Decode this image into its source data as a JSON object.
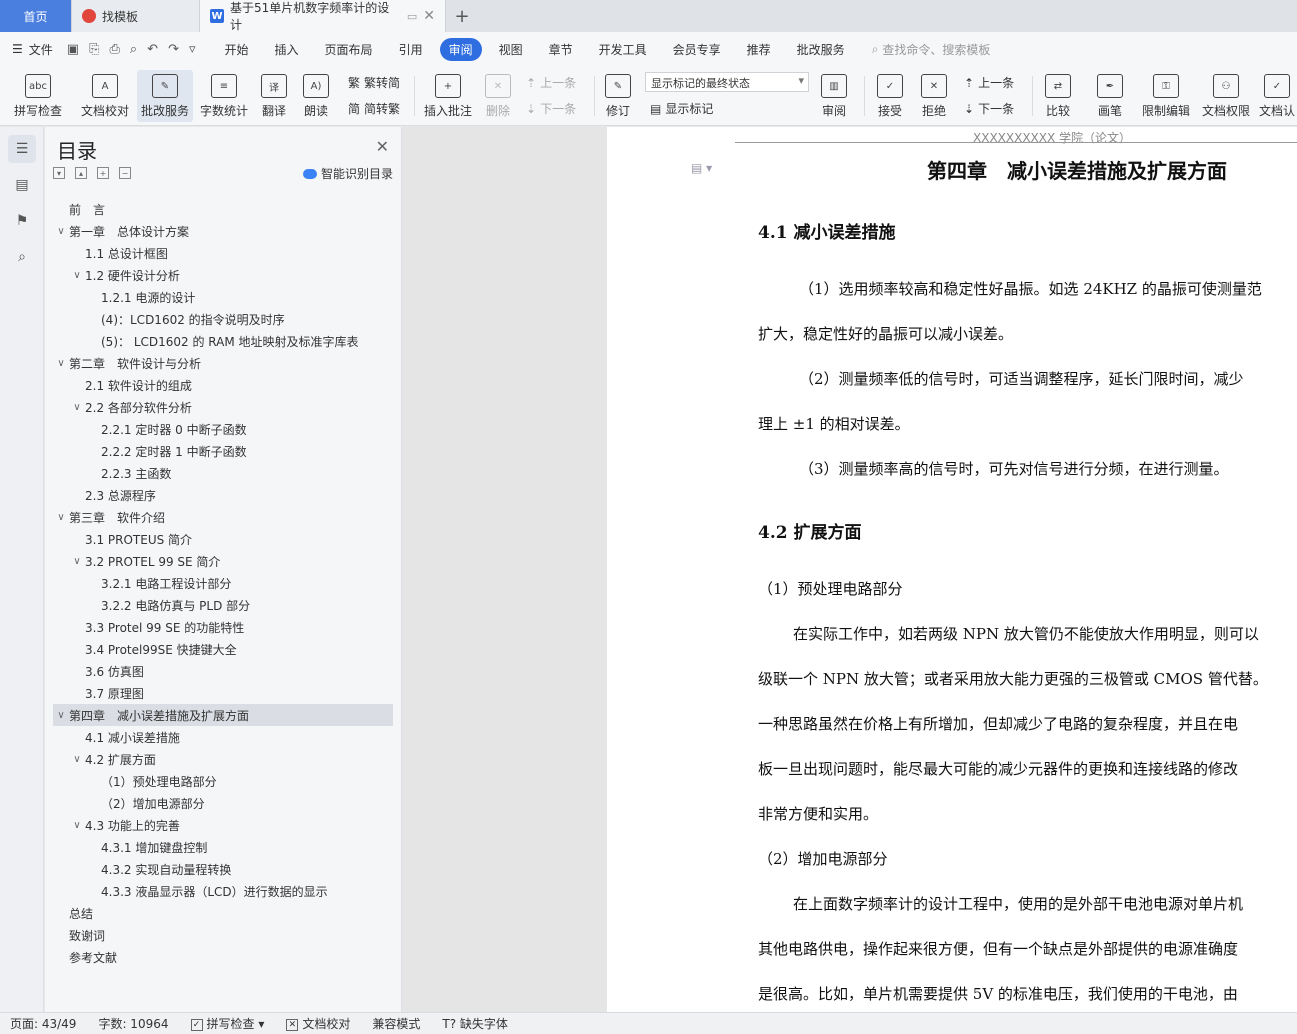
{
  "tabs": {
    "home": "首页",
    "template": "找模板",
    "doc": "基于51单片机数字频率计的设计",
    "add": "+"
  },
  "menu": {
    "file": "文件",
    "items": [
      "开始",
      "插入",
      "页面布局",
      "引用",
      "审阅",
      "视图",
      "章节",
      "开发工具",
      "会员专享",
      "推荐",
      "批改服务"
    ],
    "active_index": 4,
    "search": "查找命令、搜索模板"
  },
  "ribbon": {
    "spell": "拼写检查",
    "proofread": "文档校对",
    "correct": "批改服务",
    "wordcount": "字数统计",
    "translate": "翻译",
    "read": "朗读",
    "trad": "繁转简",
    "simp": "简转繁",
    "insert_comment": "插入批注",
    "delete": "删除",
    "prev_comment": "上一条",
    "next_comment": "下一条",
    "revise": "修订",
    "markup_state": "显示标记的最终状态",
    "show_markup": "显示标记",
    "review": "审阅",
    "accept": "接受",
    "reject": "拒绝",
    "prev": "上一条",
    "next": "下一条",
    "compare": "比较",
    "pen": "画笔",
    "restrict": "限制编辑",
    "permission": "文档权限",
    "certify": "文档认"
  },
  "toc": {
    "title": "目录",
    "smart": "智能识别目录",
    "items": [
      {
        "label": "前　言",
        "level": 0,
        "chev": false
      },
      {
        "label": "第一章　总体设计方案",
        "level": 0,
        "chev": true
      },
      {
        "label": "1.1  总设计框图",
        "level": 1,
        "chev": false
      },
      {
        "label": "1.2  硬件设计分析",
        "level": 1,
        "chev": true
      },
      {
        "label": "1.2.1  电源的设计",
        "level": 2,
        "chev": false
      },
      {
        "label": "(4)：LCD1602 的指令说明及时序",
        "level": 2,
        "chev": false
      },
      {
        "label": "(5)：  LCD1602 的 RAM 地址映射及标准字库表",
        "level": 2,
        "chev": false
      },
      {
        "label": "第二章　软件设计与分析",
        "level": 0,
        "chev": true
      },
      {
        "label": "2.1  软件设计的组成",
        "level": 1,
        "chev": false
      },
      {
        "label": "2.2    各部分软件分析",
        "level": 1,
        "chev": true
      },
      {
        "label": "2.2.1    定时器 0 中断子函数",
        "level": 2,
        "chev": false
      },
      {
        "label": "2.2.2    定时器 1 中断子函数",
        "level": 2,
        "chev": false
      },
      {
        "label": "2.2.3    主函数",
        "level": 2,
        "chev": false
      },
      {
        "label": "2.3    总源程序",
        "level": 1,
        "chev": false
      },
      {
        "label": "第三章　软件介绍",
        "level": 0,
        "chev": true
      },
      {
        "label": "3.1 PROTEUS 简介",
        "level": 1,
        "chev": false
      },
      {
        "label": "3.2 PROTEL 99 SE 简介",
        "level": 1,
        "chev": true
      },
      {
        "label": "3.2.1  电路工程设计部分",
        "level": 2,
        "chev": false
      },
      {
        "label": "3.2.2  电路仿真与 PLD 部分",
        "level": 2,
        "chev": false
      },
      {
        "label": "3.3 Protel 99 SE 的功能特性",
        "level": 1,
        "chev": false
      },
      {
        "label": "3.4 Protel99SE 快捷键大全",
        "level": 1,
        "chev": false
      },
      {
        "label": "3.6 仿真图",
        "level": 1,
        "chev": false
      },
      {
        "label": "3.7 原理图",
        "level": 1,
        "chev": false
      },
      {
        "label": "第四章　减小误差措施及扩展方面",
        "level": 0,
        "chev": true,
        "selected": true
      },
      {
        "label": "4.1 减小误差措施",
        "level": 1,
        "chev": false
      },
      {
        "label": "4.2 扩展方面",
        "level": 1,
        "chev": true
      },
      {
        "label": "（1）预处理电路部分",
        "level": 2,
        "chev": false
      },
      {
        "label": "（2）增加电源部分",
        "level": 2,
        "chev": false
      },
      {
        "label": "4.3  功能上的完善",
        "level": 1,
        "chev": true
      },
      {
        "label": "4.3.1  增加键盘控制",
        "level": 2,
        "chev": false
      },
      {
        "label": "4.3.2  实现自动量程转换",
        "level": 2,
        "chev": false
      },
      {
        "label": "4.3.3  液晶显示器（LCD）进行数据的显示",
        "level": 2,
        "chev": false
      },
      {
        "label": "总结",
        "level": 0,
        "chev": false
      },
      {
        "label": "致谢词",
        "level": 0,
        "chev": false
      },
      {
        "label": "参考文献",
        "level": 0,
        "chev": false
      }
    ]
  },
  "doc": {
    "header": "XXXXXXXXXX 学院（论文）",
    "title": "第四章　减小误差措施及扩展方面",
    "h41": "4.1 减小误差措施",
    "p1": "（1）选用频率较高和稳定性好晶振。如选 24KHZ 的晶振可使测量范",
    "p2": "扩大，稳定性好的晶振可以减小误差。",
    "p3": "（2）测量频率低的信号时，可适当调整程序，延长门限时间，减少",
    "p4": "理上 ±1 的相对误差。",
    "p5": "（3）测量频率高的信号时，可先对信号进行分频，在进行测量。",
    "h42": "4.2 扩展方面",
    "p6": "（1）预处理电路部分",
    "p7": "在实际工作中，如若两级 NPN 放大管仍不能使放大作用明显，则可以",
    "p8": "级联一个 NPN 放大管；或者采用放大能力更强的三极管或 CMOS 管代替。",
    "p9": "一种思路虽然在价格上有所增加，但却减少了电路的复杂程度，并且在电",
    "p10": "板一旦出现问题时，能尽最大可能的减少元器件的更换和连接线路的修改",
    "p11": "非常方便和实用。",
    "p12": "（2）增加电源部分",
    "p13": "在上面数字频率计的设计工程中，使用的是外部干电池电源对单片机",
    "p14": "其他电路供电，操作起来很方便，但有一个缺点是外部提供的电源准确度",
    "p15": "是很高。比如，单片机需要提供 5V 的标准电压，我们使用的干电池，由"
  },
  "status": {
    "page": "页面: 43/49",
    "words": "字数: 10964",
    "spell": "拼写检查",
    "proof": "文档校对",
    "compat": "兼容模式",
    "missing_font": "缺失字体"
  }
}
